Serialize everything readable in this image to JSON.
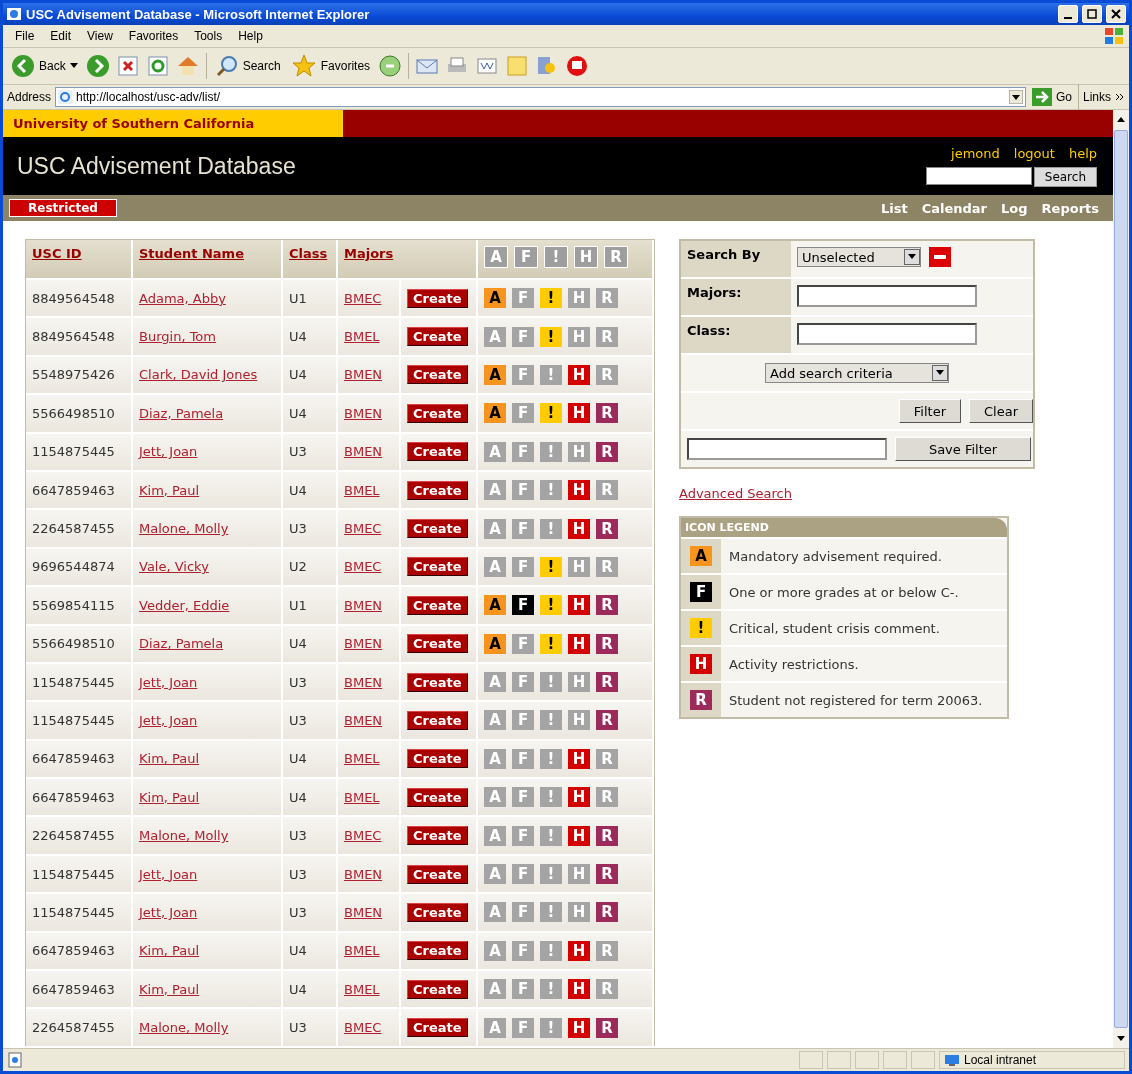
{
  "window": {
    "title": "USC Advisement Database - Microsoft Internet Explorer"
  },
  "menu": [
    "File",
    "Edit",
    "View",
    "Favorites",
    "Tools",
    "Help"
  ],
  "toolbar": {
    "back": "Back",
    "search": "Search",
    "favorites": "Favorites"
  },
  "address": {
    "label": "Address",
    "url": "http://localhost/usc-adv/list/",
    "go": "Go",
    "links": "Links"
  },
  "site": {
    "university": "University of Southern California",
    "title": "USC Advisement Database",
    "user_links": [
      "jemond",
      "logout",
      "help"
    ],
    "search_button": "Search",
    "badge": "Restricted",
    "nav": [
      "List",
      "Calendar",
      "Log",
      "Reports"
    ]
  },
  "table": {
    "columns": [
      "USC ID",
      "Student Name",
      "Class",
      "Majors"
    ],
    "flag_headers": [
      "A",
      "F",
      "!",
      "H",
      "R"
    ],
    "rows": [
      {
        "id": "8849564548",
        "name": "Adama, Abby",
        "class": "U1",
        "major": "BMEC",
        "action": "Create",
        "flags": [
          {
            "letter": "A",
            "on": true
          },
          {
            "letter": "F",
            "on": false
          },
          {
            "letter": "!",
            "on": true
          },
          {
            "letter": "H",
            "on": false
          },
          {
            "letter": "R",
            "on": false
          }
        ]
      },
      {
        "id": "8849564548",
        "name": "Burgin, Tom",
        "class": "U4",
        "major": "BMEL",
        "action": "Create",
        "flags": [
          {
            "letter": "A",
            "on": false
          },
          {
            "letter": "F",
            "on": false
          },
          {
            "letter": "!",
            "on": true
          },
          {
            "letter": "H",
            "on": false
          },
          {
            "letter": "R",
            "on": false
          }
        ]
      },
      {
        "id": "5548975426",
        "name": "Clark, David Jones",
        "class": "U4",
        "major": "BMEN",
        "action": "Create",
        "flags": [
          {
            "letter": "A",
            "on": true
          },
          {
            "letter": "F",
            "on": false
          },
          {
            "letter": "!",
            "on": false
          },
          {
            "letter": "H",
            "on": true
          },
          {
            "letter": "R",
            "on": false
          }
        ]
      },
      {
        "id": "5566498510",
        "name": "Diaz, Pamela",
        "class": "U4",
        "major": "BMEN",
        "action": "Create",
        "flags": [
          {
            "letter": "A",
            "on": true
          },
          {
            "letter": "F",
            "on": false
          },
          {
            "letter": "!",
            "on": true
          },
          {
            "letter": "H",
            "on": true
          },
          {
            "letter": "R",
            "on": true
          }
        ]
      },
      {
        "id": "1154875445",
        "name": "Jett, Joan",
        "class": "U3",
        "major": "BMEN",
        "action": "Create",
        "flags": [
          {
            "letter": "A",
            "on": false
          },
          {
            "letter": "F",
            "on": false
          },
          {
            "letter": "!",
            "on": false
          },
          {
            "letter": "H",
            "on": false
          },
          {
            "letter": "R",
            "on": true
          }
        ]
      },
      {
        "id": "6647859463",
        "name": "Kim, Paul",
        "class": "U4",
        "major": "BMEL",
        "action": "Create",
        "flags": [
          {
            "letter": "A",
            "on": false
          },
          {
            "letter": "F",
            "on": false
          },
          {
            "letter": "!",
            "on": false
          },
          {
            "letter": "H",
            "on": true
          },
          {
            "letter": "R",
            "on": false
          }
        ]
      },
      {
        "id": "2264587455",
        "name": "Malone, Molly",
        "class": "U3",
        "major": "BMEC",
        "action": "Create",
        "flags": [
          {
            "letter": "A",
            "on": false
          },
          {
            "letter": "F",
            "on": false
          },
          {
            "letter": "!",
            "on": false
          },
          {
            "letter": "H",
            "on": true
          },
          {
            "letter": "R",
            "on": true
          }
        ]
      },
      {
        "id": "9696544874",
        "name": "Vale, Vicky",
        "class": "U2",
        "major": "BMEC",
        "action": "Create",
        "flags": [
          {
            "letter": "A",
            "on": false
          },
          {
            "letter": "F",
            "on": false
          },
          {
            "letter": "!",
            "on": true
          },
          {
            "letter": "H",
            "on": false
          },
          {
            "letter": "R",
            "on": false
          }
        ]
      },
      {
        "id": "5569854115",
        "name": "Vedder, Eddie",
        "class": "U1",
        "major": "BMEN",
        "action": "Create",
        "flags": [
          {
            "letter": "A",
            "on": true
          },
          {
            "letter": "F",
            "on": true
          },
          {
            "letter": "!",
            "on": true
          },
          {
            "letter": "H",
            "on": true
          },
          {
            "letter": "R",
            "on": true
          }
        ]
      },
      {
        "id": "5566498510",
        "name": "Diaz, Pamela",
        "class": "U4",
        "major": "BMEN",
        "action": "Create",
        "flags": [
          {
            "letter": "A",
            "on": true
          },
          {
            "letter": "F",
            "on": false
          },
          {
            "letter": "!",
            "on": true
          },
          {
            "letter": "H",
            "on": true
          },
          {
            "letter": "R",
            "on": true
          }
        ]
      },
      {
        "id": "1154875445",
        "name": "Jett, Joan",
        "class": "U3",
        "major": "BMEN",
        "action": "Create",
        "flags": [
          {
            "letter": "A",
            "on": false
          },
          {
            "letter": "F",
            "on": false
          },
          {
            "letter": "!",
            "on": false
          },
          {
            "letter": "H",
            "on": false
          },
          {
            "letter": "R",
            "on": true
          }
        ]
      },
      {
        "id": "1154875445",
        "name": "Jett, Joan",
        "class": "U3",
        "major": "BMEN",
        "action": "Create",
        "flags": [
          {
            "letter": "A",
            "on": false
          },
          {
            "letter": "F",
            "on": false
          },
          {
            "letter": "!",
            "on": false
          },
          {
            "letter": "H",
            "on": false
          },
          {
            "letter": "R",
            "on": true
          }
        ]
      },
      {
        "id": "6647859463",
        "name": "Kim, Paul",
        "class": "U4",
        "major": "BMEL",
        "action": "Create",
        "flags": [
          {
            "letter": "A",
            "on": false
          },
          {
            "letter": "F",
            "on": false
          },
          {
            "letter": "!",
            "on": false
          },
          {
            "letter": "H",
            "on": true
          },
          {
            "letter": "R",
            "on": false
          }
        ]
      },
      {
        "id": "6647859463",
        "name": "Kim, Paul",
        "class": "U4",
        "major": "BMEL",
        "action": "Create",
        "flags": [
          {
            "letter": "A",
            "on": false
          },
          {
            "letter": "F",
            "on": false
          },
          {
            "letter": "!",
            "on": false
          },
          {
            "letter": "H",
            "on": true
          },
          {
            "letter": "R",
            "on": false
          }
        ]
      },
      {
        "id": "2264587455",
        "name": "Malone, Molly",
        "class": "U3",
        "major": "BMEC",
        "action": "Create",
        "flags": [
          {
            "letter": "A",
            "on": false
          },
          {
            "letter": "F",
            "on": false
          },
          {
            "letter": "!",
            "on": false
          },
          {
            "letter": "H",
            "on": true
          },
          {
            "letter": "R",
            "on": true
          }
        ]
      },
      {
        "id": "1154875445",
        "name": "Jett, Joan",
        "class": "U3",
        "major": "BMEN",
        "action": "Create",
        "flags": [
          {
            "letter": "A",
            "on": false
          },
          {
            "letter": "F",
            "on": false
          },
          {
            "letter": "!",
            "on": false
          },
          {
            "letter": "H",
            "on": false
          },
          {
            "letter": "R",
            "on": true
          }
        ]
      },
      {
        "id": "1154875445",
        "name": "Jett, Joan",
        "class": "U3",
        "major": "BMEN",
        "action": "Create",
        "flags": [
          {
            "letter": "A",
            "on": false
          },
          {
            "letter": "F",
            "on": false
          },
          {
            "letter": "!",
            "on": false
          },
          {
            "letter": "H",
            "on": false
          },
          {
            "letter": "R",
            "on": true
          }
        ]
      },
      {
        "id": "6647859463",
        "name": "Kim, Paul",
        "class": "U4",
        "major": "BMEL",
        "action": "Create",
        "flags": [
          {
            "letter": "A",
            "on": false
          },
          {
            "letter": "F",
            "on": false
          },
          {
            "letter": "!",
            "on": false
          },
          {
            "letter": "H",
            "on": true
          },
          {
            "letter": "R",
            "on": false
          }
        ]
      },
      {
        "id": "6647859463",
        "name": "Kim, Paul",
        "class": "U4",
        "major": "BMEL",
        "action": "Create",
        "flags": [
          {
            "letter": "A",
            "on": false
          },
          {
            "letter": "F",
            "on": false
          },
          {
            "letter": "!",
            "on": false
          },
          {
            "letter": "H",
            "on": true
          },
          {
            "letter": "R",
            "on": false
          }
        ]
      },
      {
        "id": "2264587455",
        "name": "Malone, Molly",
        "class": "U3",
        "major": "BMEC",
        "action": "Create",
        "flags": [
          {
            "letter": "A",
            "on": false
          },
          {
            "letter": "F",
            "on": false
          },
          {
            "letter": "!",
            "on": false
          },
          {
            "letter": "H",
            "on": true
          },
          {
            "letter": "R",
            "on": true
          }
        ]
      }
    ]
  },
  "search_panel": {
    "search_by_label": "Search By",
    "search_by_value": "Unselected",
    "fields": [
      {
        "label": "Majors:"
      },
      {
        "label": "Class:"
      }
    ],
    "add_criteria": "Add search criteria",
    "filter": "Filter",
    "clear": "Clear",
    "save_filter": "Save Filter"
  },
  "advanced_search": "Advanced Search",
  "legend": {
    "title": "ICON LEGEND",
    "items": [
      {
        "letter": "A",
        "text": "Mandatory advisement required.",
        "color": "#f7941d"
      },
      {
        "letter": "F",
        "text": "One or more grades at or below C-.",
        "color": "#000000"
      },
      {
        "letter": "!",
        "text": "Critical, student crisis comment.",
        "color": "#ffcc00"
      },
      {
        "letter": "H",
        "text": "Activity restrictions.",
        "color": "#d40000"
      },
      {
        "letter": "R",
        "text": "Student not registered for term 20063.",
        "color": "#9c2a5a"
      }
    ]
  },
  "status_bar": {
    "zone": "Local intranet"
  }
}
